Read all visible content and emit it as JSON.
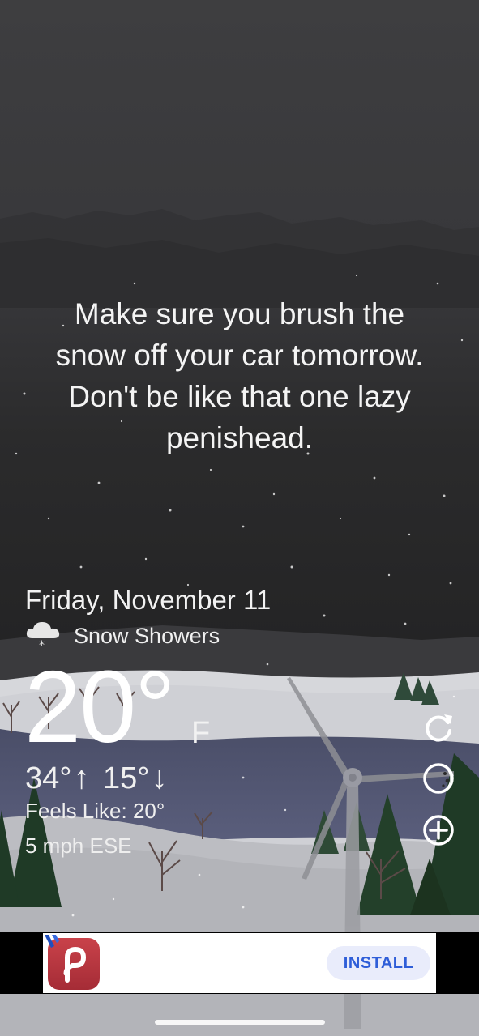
{
  "message": {
    "lines": [
      "Make sure you brush the",
      "snow off your car tomorrow.",
      "Don't be like that one lazy",
      "penishead."
    ]
  },
  "weather": {
    "date": "Friday, November 11",
    "condition": "Snow Showers",
    "condition_icon": "cloud-snow-icon",
    "temperature": "20°",
    "unit": "F",
    "high": "34°",
    "low": "15°",
    "feels_like": "Feels Like: 20°",
    "wind": "5 mph ESE"
  },
  "side_buttons": {
    "refresh_icon": "refresh-icon",
    "moon_icon": "moon-icon",
    "add_icon": "add-icon"
  },
  "ad": {
    "logo_icon": "app-logo-icon",
    "install_label": "INSTALL"
  }
}
